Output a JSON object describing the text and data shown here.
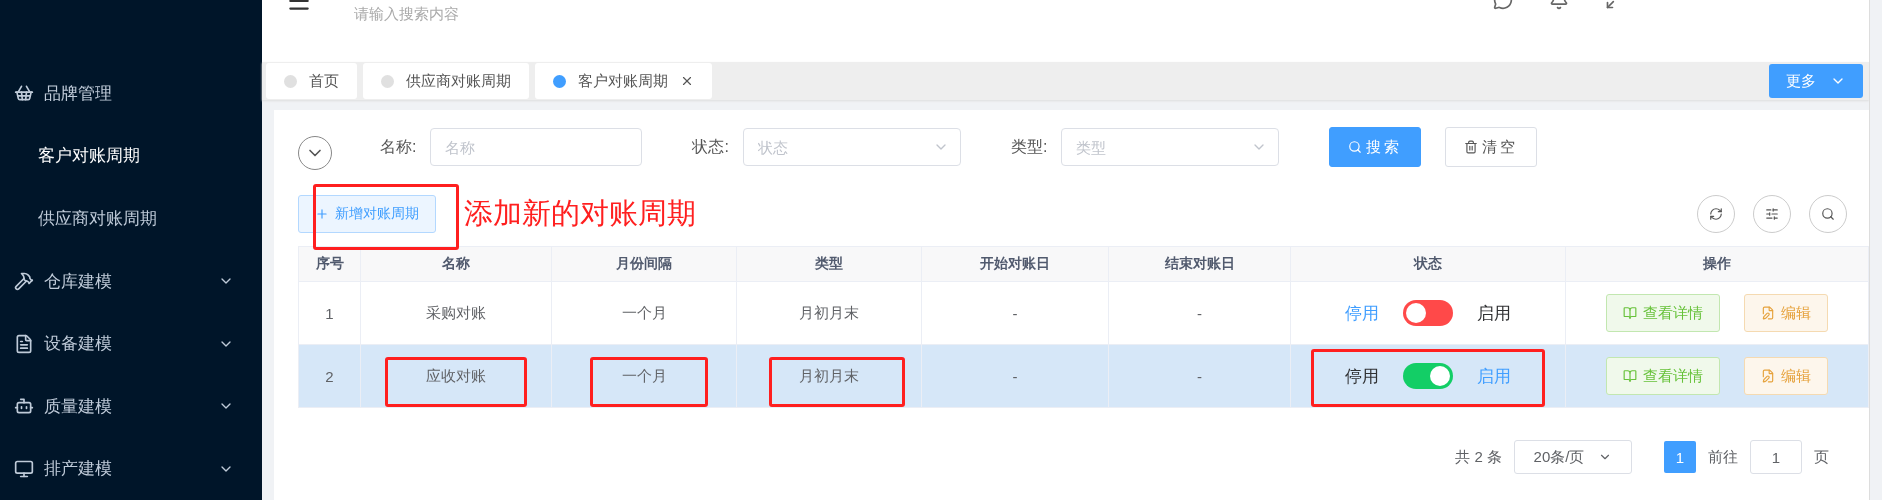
{
  "header": {
    "search_placeholder": "请输入搜索内容"
  },
  "sidebar": {
    "items": [
      {
        "kind": "link",
        "label": "品牌管理",
        "selected": false
      },
      {
        "kind": "sub",
        "label": "客户对账周期",
        "selected": true
      },
      {
        "kind": "sub",
        "label": "供应商对账周期",
        "selected": false
      },
      {
        "kind": "group",
        "label": "仓库建模",
        "expanded": false
      },
      {
        "kind": "group",
        "label": "设备建模",
        "expanded": false
      },
      {
        "kind": "group",
        "label": "质量建模",
        "expanded": false
      },
      {
        "kind": "group",
        "label": "排产建模",
        "expanded": false
      }
    ]
  },
  "tabs": [
    {
      "label": "首页",
      "selected": false,
      "closable": false
    },
    {
      "label": "供应商对账周期",
      "selected": false,
      "closable": false
    },
    {
      "label": "客户对账周期",
      "selected": true,
      "closable": true
    }
  ],
  "more_button": "更多",
  "filters": [
    {
      "kind": "text",
      "label": "名称:",
      "placeholder": "名称"
    },
    {
      "kind": "select",
      "label": "状态:",
      "placeholder": "状态"
    },
    {
      "kind": "select",
      "label": "类型:",
      "placeholder": "类型"
    }
  ],
  "search_button": "搜索",
  "clear_button": "清空",
  "add_button": {
    "label": "新增对账周期",
    "annotated": true
  },
  "annotation": "添加新的对账周期",
  "table": {
    "columns": [
      "序号",
      "名称",
      "月份间隔",
      "类型",
      "开始对账日",
      "结束对账日",
      "状态",
      "操作"
    ],
    "rows": [
      {
        "index": "1",
        "name": "采购对账",
        "interval": "一个月",
        "type": "月初月末",
        "start": "-",
        "end": "-",
        "off_label": "停用",
        "on_label": "启用",
        "on": false,
        "selected": false,
        "annotated": false,
        "actions": [
          "查看详情",
          "编辑"
        ]
      },
      {
        "index": "2",
        "name": "应收对账",
        "interval": "一个月",
        "type": "月初月末",
        "start": "-",
        "end": "-",
        "off_label": "停用",
        "on_label": "启用",
        "on": true,
        "selected": true,
        "annotated": true,
        "actions": [
          "查看详情",
          "编辑"
        ]
      }
    ]
  },
  "pagination": {
    "total": "共 2 条",
    "page_size": "20条/页",
    "pages": [
      {
        "label": "1",
        "selected": true
      }
    ],
    "goto_label": "前往",
    "goto_value": "1",
    "goto_suffix": "页"
  }
}
